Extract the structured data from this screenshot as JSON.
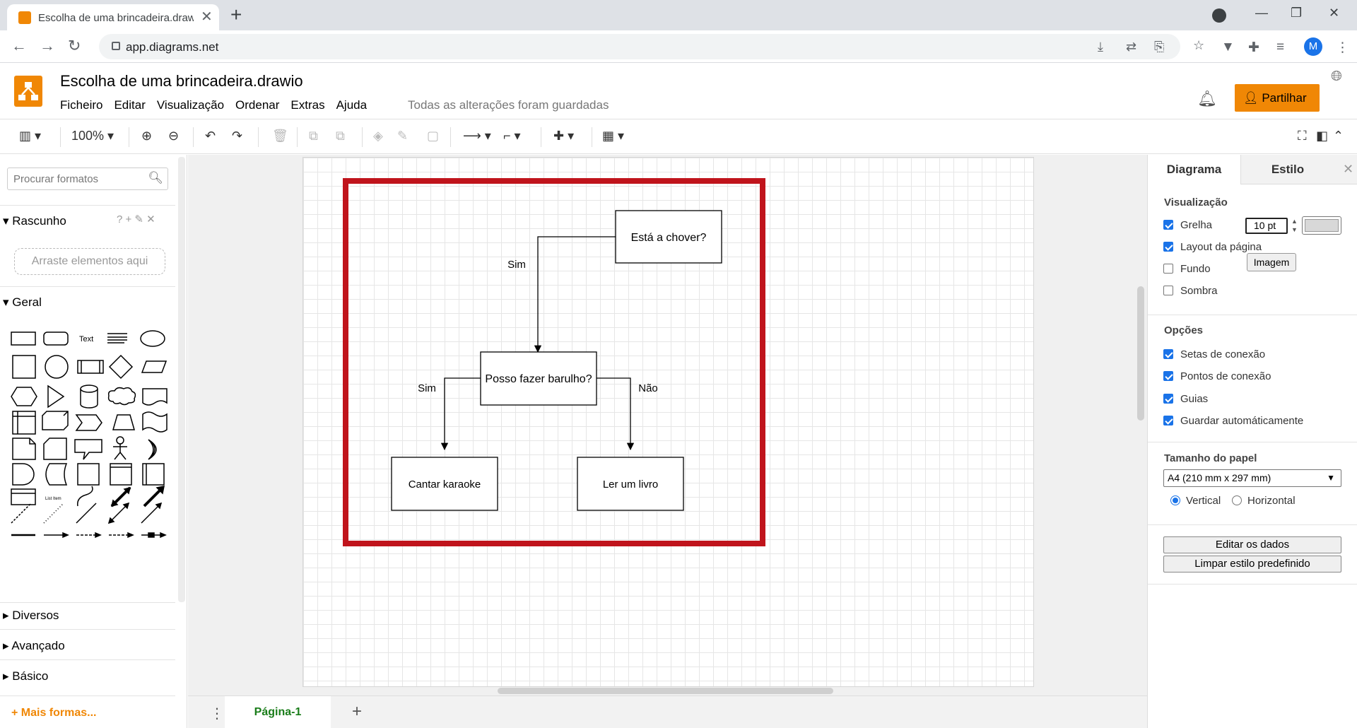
{
  "browser": {
    "tab_title": "Escolha de uma brincadeira.drawio",
    "tab_close": "✕",
    "new_tab": "+",
    "url": "app.diagrams.net",
    "avatar_letter": "M"
  },
  "app": {
    "doc_title": "Escolha de uma brincadeira.drawio",
    "menus": [
      "Ficheiro",
      "Editar",
      "Visualização",
      "Ordenar",
      "Extras",
      "Ajuda"
    ],
    "save_status": "Todas as alterações foram guardadas",
    "share_label": "Partilhar",
    "accent_color": "#f08705"
  },
  "toolbar": {
    "zoom": "100%"
  },
  "left_panel": {
    "search_placeholder": "Procurar formatos",
    "scratchpad": "Rascunho",
    "scratchpad_tools": "? + ✎ ✕",
    "drop_hint": "Arraste elementos aqui",
    "general": "Geral",
    "text_shape_label": "Text",
    "list_item_label": "List Item",
    "sections": [
      "Diversos",
      "Avançado",
      "Básico"
    ],
    "more_shapes": "+ Mais formas..."
  },
  "diagram": {
    "frame_color": "#c0141c",
    "nodes": {
      "question1": "Está a chover?",
      "question2": "Posso fazer barulho?",
      "option_yes": "Cantar karaoke",
      "option_no": "Ler um livro"
    },
    "edge_labels": {
      "q1_yes": "Sim",
      "q2_yes": "Sim",
      "q2_no": "Não"
    }
  },
  "page_tabs": {
    "active": "Página-1"
  },
  "right_panel": {
    "tabs": [
      "Diagrama",
      "Estilo"
    ],
    "view_section": "Visualização",
    "grid": {
      "label": "Grelha",
      "checked": true,
      "size": "10 pt"
    },
    "page_layout": {
      "label": "Layout da página",
      "checked": true
    },
    "background": {
      "label": "Fundo",
      "checked": false,
      "button": "Imagem"
    },
    "shadow": {
      "label": "Sombra",
      "checked": false
    },
    "options_section": "Opções",
    "options": [
      {
        "label": "Setas de conexão",
        "checked": true
      },
      {
        "label": "Pontos de conexão",
        "checked": true
      },
      {
        "label": "Guias",
        "checked": true
      },
      {
        "label": "Guardar automáticamente",
        "checked": true
      }
    ],
    "paper_section": "Tamanho do papel",
    "paper_size": "A4 (210 mm x 297 mm)",
    "orientation": {
      "vertical": "Vertical",
      "horizontal": "Horizontal",
      "selected": "vertical"
    },
    "edit_data": "Editar os dados",
    "clear_style": "Limpar estilo predefinido"
  }
}
